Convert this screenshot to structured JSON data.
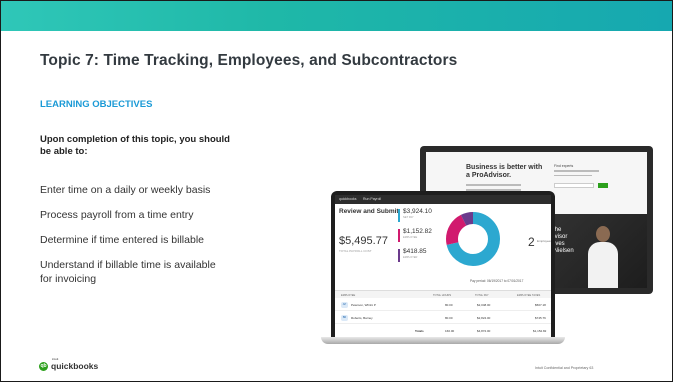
{
  "slide": {
    "title": "Topic 7: Time Tracking, Employees, and Subcontractors",
    "section_label": "LEARNING OBJECTIVES",
    "intro_line1": "Upon completion of this topic, you should",
    "intro_line2": "be able to:",
    "objectives": [
      "Enter time on a daily or weekly basis",
      "Process payroll from a time entry",
      "Determine if time entered is billable",
      "Understand if billable time is available",
      "for invoicing"
    ],
    "brand": {
      "mark": "qb",
      "small": "intuit",
      "name": "quickbooks"
    },
    "footer_text": "Intuit Confidential and Proprietary  63"
  },
  "laptop": {
    "nav_logo": "quickbooks",
    "nav_title": "Run Payroll",
    "heading": "Review and Submit",
    "total_amount": "$5,495.77",
    "total_label": "TOTAL PAYROLL COST",
    "breakdown": [
      {
        "amount": "$3,924.10",
        "label": "NET PAY",
        "color": "#2ca8d0"
      },
      {
        "amount": "$1,152.82",
        "label": "EMPLOYEE",
        "color": "#d11a6e"
      },
      {
        "amount": "$418.85",
        "label": "EMPLOYER",
        "color": "#6b3a8c"
      }
    ],
    "donut_slices": [
      {
        "value": 71.4,
        "color": "#2ca8d0"
      },
      {
        "value": 21.0,
        "color": "#d11a6e"
      },
      {
        "value": 7.6,
        "color": "#6b3a8c"
      }
    ],
    "employee_count": "2",
    "employee_count_label": "Employees",
    "period": "Pay period: 06/19/2017 to 07/01/2017",
    "columns": [
      "EMPLOYEE",
      "TOTAL HOURS",
      "TOTAL PAY",
      "EMPLOYEE TAXES"
    ],
    "rows": [
      {
        "initials": "AP",
        "name": "Peterson, Whitni P",
        "hours": "80.00",
        "pay": "$2,048.00",
        "taxes": "$507.18"
      },
      {
        "initials": "BR",
        "name": "Roberts, Barney",
        "hours": "80.00",
        "pay": "$2,824.00",
        "taxes": "$745.76"
      }
    ],
    "totals": {
      "label": "Totals",
      "hours": "160.00",
      "pay": "$4,872.00",
      "taxes": "$1,152.82"
    }
  },
  "monitor": {
    "headline": "Business is better with a ProAdvisor.",
    "side_title": "Find experts",
    "hero_text": "Meet the ProAdvisor who loves Cody Nielsen"
  }
}
